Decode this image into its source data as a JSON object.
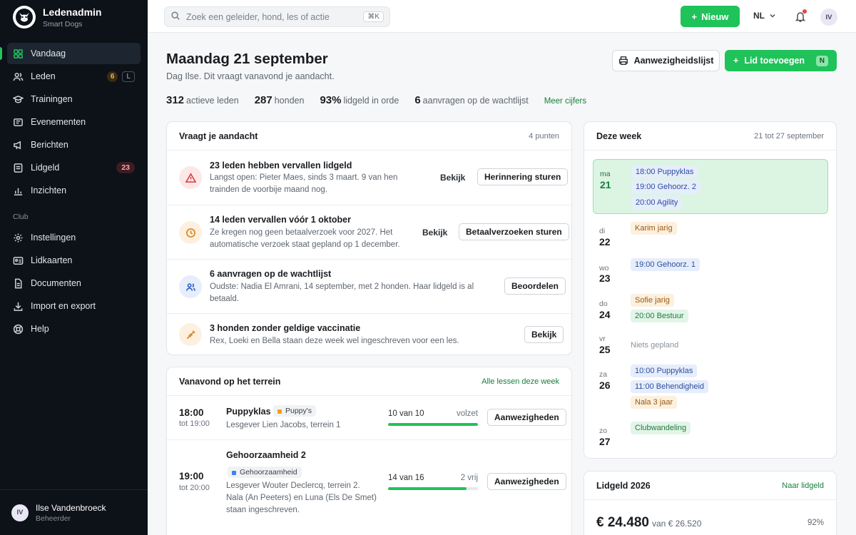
{
  "brand": {
    "title": "Ledenadmin",
    "subtitle": "Smart Dogs"
  },
  "sidebar": {
    "items": [
      {
        "label": "Vandaag",
        "icon": "grid-icon",
        "active": true
      },
      {
        "label": "Leden",
        "icon": "users-icon",
        "badge": "6",
        "key": "L"
      },
      {
        "label": "Trainingen",
        "icon": "graduation-cap-icon"
      },
      {
        "label": "Evenementen",
        "icon": "ticket-icon"
      },
      {
        "label": "Berichten",
        "icon": "megaphone-icon"
      },
      {
        "label": "Lidgeld",
        "icon": "wallet-icon",
        "badge": "23"
      },
      {
        "label": "Inzichten",
        "icon": "bar-chart-icon"
      }
    ],
    "section_label": "Club",
    "club_items": [
      {
        "label": "Instellingen",
        "icon": "gear-icon"
      },
      {
        "label": "Lidkaarten",
        "icon": "id-card-icon"
      },
      {
        "label": "Documenten",
        "icon": "document-icon"
      },
      {
        "label": "Import en export",
        "icon": "download-icon"
      },
      {
        "label": "Help",
        "icon": "help-icon"
      }
    ],
    "user": {
      "initials": "IV",
      "name": "Ilse Vandenbroeck",
      "role": "Beheerder"
    }
  },
  "topbar": {
    "search_placeholder": "Zoek een geleider, hond, les of actie",
    "search_shortcut": "⌘K",
    "new_label": "Nieuw",
    "language": "NL",
    "avatar_initials": "IV"
  },
  "header": {
    "title": "Maandag 21 september",
    "subtitle": "Dag Ilse. Dit vraagt vanavond je aandacht.",
    "print_label": "Aanwezigheidslijst",
    "add_member_label": "Lid toevoegen",
    "add_member_key": "N"
  },
  "stats": [
    {
      "value": "312",
      "label": "actieve leden"
    },
    {
      "value": "287",
      "label": "honden"
    },
    {
      "value": "93%",
      "label": "lidgeld in orde"
    },
    {
      "value": "6",
      "label": "aanvragen op de wachtlijst"
    }
  ],
  "stats_link": "Meer cijfers",
  "attention": {
    "title": "Vraagt je aandacht",
    "meta": "4 punten",
    "items": [
      {
        "title": "23 leden hebben vervallen lidgeld",
        "desc1": "Langst open: Pieter Maes, sinds 3 maart. 9 van hen",
        "desc2": "trainden de voorbije maand nog.",
        "ghost": "Bekijk",
        "button": "Herinnering sturen",
        "icon": "warning-icon"
      },
      {
        "title": "14 leden vervallen vóór 1 oktober",
        "desc1": "Ze kregen nog geen betaalverzoek voor 2027. Het",
        "desc2": "automatische verzoek staat gepland op 1 december.",
        "ghost": "Bekijk",
        "button": "Betaalverzoeken sturen",
        "icon": "clock-icon"
      },
      {
        "title": "6 aanvragen op de wachtlijst",
        "desc1": "Oudste: Nadia El Amrani, 14 september, met 2 honden. Haar lidgeld is al",
        "desc2": "betaald.",
        "button": "Beoordelen",
        "icon": "users-icon"
      },
      {
        "title": "3 honden zonder geldige vaccinatie",
        "desc1": "Rex, Loeki en Bella staan deze week wel ingeschreven voor een les.",
        "desc2": "",
        "button": "Bekijk",
        "icon": "syringe-icon"
      }
    ]
  },
  "tonight": {
    "title": "Vanavond op het terrein",
    "link": "Alle lessen deze week",
    "lessons": [
      {
        "time": "18:00",
        "until": "tot 19:00",
        "name": "Puppyklas",
        "tag": "Puppy's",
        "desc1": "Lesgever Lien Jacobs, terrein 1",
        "desc2": "",
        "desc3": "",
        "cap": "10 van 10",
        "status": "volzet",
        "fill": 1.0,
        "button": "Aanwezigheden"
      },
      {
        "time": "19:00",
        "until": "tot 20:00",
        "name": "Gehoorzaamheid 2",
        "tag": "Gehoorzaamheid",
        "desc1": "Lesgever Wouter Declercq, terrein 2.",
        "desc2": "Nala (An Peeters) en Luna (Els De Smet)",
        "desc3": "staan ingeschreven.",
        "cap": "14 van 16",
        "status": "2 vrij",
        "fill": 0.875,
        "button": "Aanwezigheden"
      }
    ]
  },
  "week": {
    "title": "Deze week",
    "range": "21 tot 27 september",
    "days": [
      {
        "dow": "ma",
        "num": "21",
        "events": [
          {
            "label": "18:00 Puppyklas",
            "type": "blue"
          },
          {
            "label": "19:00 Gehoorz. 2",
            "type": "blue"
          },
          {
            "label": "20:00 Agility",
            "type": "blue"
          }
        ]
      },
      {
        "dow": "di",
        "num": "22",
        "events": [
          {
            "label": "Karim jarig",
            "type": "orange"
          }
        ]
      },
      {
        "dow": "wo",
        "num": "23",
        "events": [
          {
            "label": "19:00 Gehoorz. 1",
            "type": "blue"
          }
        ]
      },
      {
        "dow": "do",
        "num": "24",
        "events": [
          {
            "label": "Sofie jarig",
            "type": "orange"
          },
          {
            "label": "20:00 Bestuur",
            "type": "green"
          }
        ]
      },
      {
        "dow": "vr",
        "num": "25",
        "events": [
          {
            "label": "Niets gepland",
            "type": "none"
          }
        ]
      },
      {
        "dow": "za",
        "num": "26",
        "events": [
          {
            "label": "10:00 Puppyklas",
            "type": "blue"
          },
          {
            "label": "11:00 Behendigheid",
            "type": "blue"
          },
          {
            "label": "Nala 3 jaar",
            "type": "orange"
          }
        ]
      },
      {
        "dow": "zo",
        "num": "27",
        "events": [
          {
            "label": "Clubwandeling",
            "type": "green"
          }
        ]
      }
    ]
  },
  "fees": {
    "title": "Lidgeld 2026",
    "link": "Naar lidgeld",
    "amount": "€ 24.480",
    "of": "van € 26.520",
    "percent": "92%"
  }
}
